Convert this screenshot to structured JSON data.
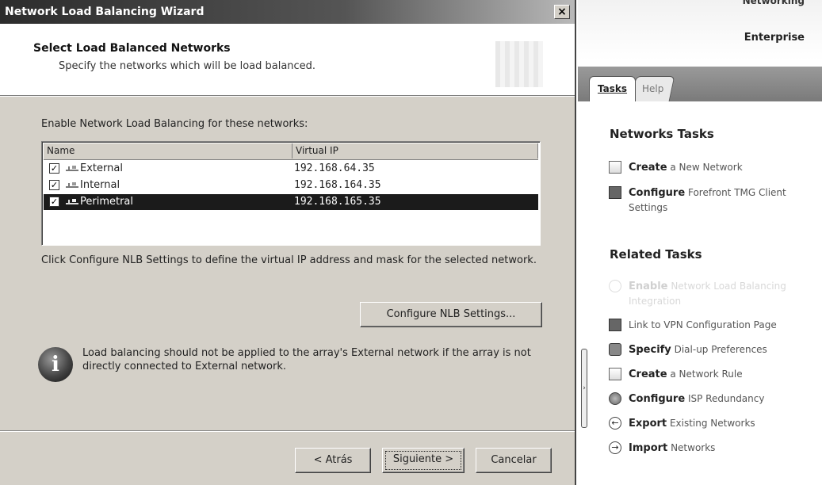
{
  "wizard": {
    "title": "Network Load Balancing Wizard",
    "close_glyph": "×",
    "header": {
      "title": "Select Load Balanced Networks",
      "subtitle": "Specify the networks which will be load balanced."
    },
    "enable_label": "Enable Network Load Balancing for these networks:",
    "columns": [
      "Name",
      "Virtual IP"
    ],
    "networks": [
      {
        "name": "External",
        "ip": "192.168.64.35",
        "checked": true,
        "selected": false
      },
      {
        "name": "Internal",
        "ip": "192.168.164.35",
        "checked": true,
        "selected": false
      },
      {
        "name": "Perimetral",
        "ip": "192.168.165.35",
        "checked": true,
        "selected": true
      }
    ],
    "check_glyph": "✓",
    "configure_hint": "Click Configure NLB Settings to define the virtual IP address and mask for the selected network.",
    "configure_button": "Configure NLB Settings...",
    "info_glyph": "i",
    "info_note": "Load balancing should not be applied to the array's External network if the array is not directly connected to External network.",
    "buttons": {
      "back": "< Atrás",
      "next": "Siguiente >",
      "cancel": "Cancelar"
    }
  },
  "pane": {
    "cut_header": "Networking",
    "edition": "Enterprise",
    "tabs": {
      "tasks": "Tasks",
      "help": "Help"
    },
    "networks_tasks_title": "Networks Tasks",
    "networks_tasks": [
      {
        "bold": "Create",
        "rest": " a New Network",
        "icon": "document-icon"
      },
      {
        "bold": "Configure",
        "rest": " Forefront TMG Client Settings",
        "icon": "monitor-icon"
      }
    ],
    "related_tasks_title": "Related Tasks",
    "related_tasks": [
      {
        "bold": "Enable",
        "rest": " Network Load Balancing Integration",
        "icon": "faded-icon",
        "faded": true
      },
      {
        "bold": "",
        "rest": "Link to VPN Configuration Page",
        "icon": "link-icon"
      },
      {
        "bold": "Specify",
        "rest": " Dial-up Preferences",
        "icon": "phone-icon"
      },
      {
        "bold": "Create",
        "rest": " a Network Rule",
        "icon": "document-icon"
      },
      {
        "bold": "Configure",
        "rest": " ISP Redundancy",
        "icon": "globe-icon"
      },
      {
        "bold": "Export",
        "rest": " Existing Networks",
        "icon": "export-icon"
      },
      {
        "bold": "Import",
        "rest": " Networks",
        "icon": "import-icon"
      }
    ],
    "splitter_glyph": "›"
  }
}
